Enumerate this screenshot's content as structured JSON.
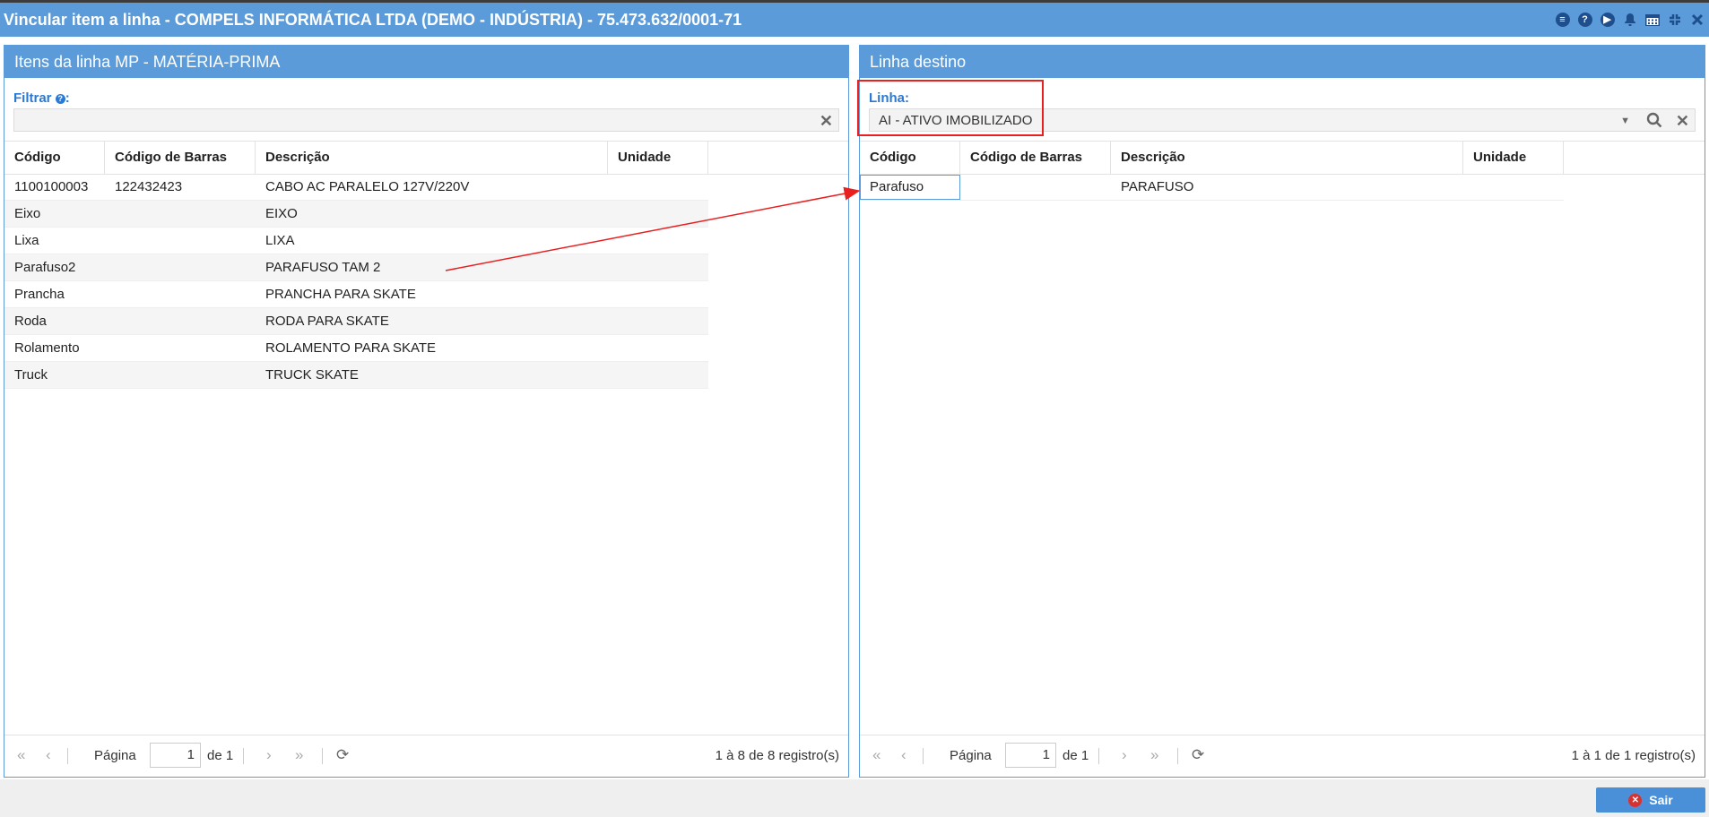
{
  "window": {
    "title": "Vincular item a linha - COMPELS INFORMÁTICA LTDA (DEMO - INDÚSTRIA) - 75.473.632/0001-71"
  },
  "left_panel": {
    "title": "Itens da linha MP - MATÉRIA-PRIMA",
    "filter_label": "Filtrar",
    "filter_value": "",
    "columns": [
      "Código",
      "Código de Barras",
      "Descrição",
      "Unidade"
    ],
    "rows": [
      {
        "codigo": "1100100003",
        "barras": "122432423",
        "descricao": "CABO AC PARALELO 127V/220V",
        "unidade": ""
      },
      {
        "codigo": "Eixo",
        "barras": "",
        "descricao": "EIXO",
        "unidade": ""
      },
      {
        "codigo": "Lixa",
        "barras": "",
        "descricao": "LIXA",
        "unidade": ""
      },
      {
        "codigo": "Parafuso2",
        "barras": "",
        "descricao": "PARAFUSO TAM 2",
        "unidade": ""
      },
      {
        "codigo": "Prancha",
        "barras": "",
        "descricao": "PRANCHA PARA SKATE",
        "unidade": ""
      },
      {
        "codigo": "Roda",
        "barras": "",
        "descricao": "RODA PARA SKATE",
        "unidade": ""
      },
      {
        "codigo": "Rolamento",
        "barras": "",
        "descricao": "ROLAMENTO PARA SKATE",
        "unidade": ""
      },
      {
        "codigo": "Truck",
        "barras": "",
        "descricao": "TRUCK SKATE",
        "unidade": ""
      }
    ],
    "pager": {
      "page_label": "Página",
      "page": "1",
      "of_label": "de 1",
      "info": "1 à 8 de 8 registro(s)"
    }
  },
  "right_panel": {
    "title": "Linha destino",
    "linha_label": "Linha:",
    "linha_value": "AI - ATIVO IMOBILIZADO",
    "columns": [
      "Código",
      "Código de Barras",
      "Descrição",
      "Unidade"
    ],
    "rows": [
      {
        "codigo": "Parafuso",
        "barras": "",
        "descricao": "PARAFUSO",
        "unidade": ""
      }
    ],
    "pager": {
      "page_label": "Página",
      "page": "1",
      "of_label": "de 1",
      "info": "1 à 1 de 1 registro(s)"
    }
  },
  "footer": {
    "exit_label": "Sair"
  },
  "colors": {
    "accent": "#5b9bd9",
    "annotation": "#e82020"
  }
}
